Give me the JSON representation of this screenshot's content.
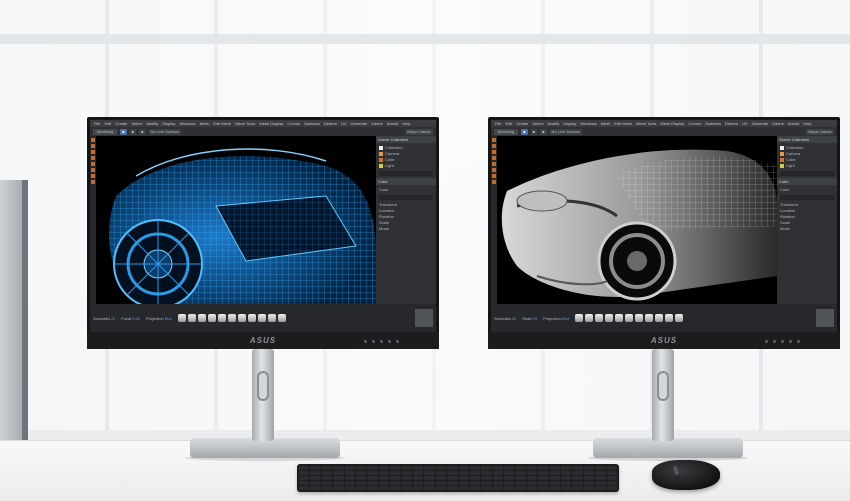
{
  "app": {
    "menu": [
      "File",
      "Edit",
      "Create",
      "Select",
      "Modify",
      "Display",
      "Windows",
      "Mesh",
      "Edit Mesh",
      "Mesh Tools",
      "Mesh Display",
      "Curves",
      "Surfaces",
      "Deform",
      "UV",
      "Generate",
      "Cache",
      "Arnold",
      "Help"
    ],
    "mode": "Modeling",
    "tool_chips": [
      "No Live Surface"
    ],
    "workspace": "Maya Classic"
  },
  "panel": {
    "outliner_title": "Scene Collection",
    "outliner_items": [
      {
        "label": "Collection",
        "color": "#f0f0f0"
      },
      {
        "label": "Camera",
        "color": "#e0a040"
      },
      {
        "label": "Cube",
        "color": "#e07030"
      },
      {
        "label": "Light",
        "color": "#d0d040"
      }
    ],
    "properties_title": "Cube",
    "section_color": "Color",
    "section_transform": "Transform",
    "fields": [
      "Location",
      "Rotation",
      "Scale",
      "Mode"
    ],
    "bottom_labels": [
      {
        "label": "Schmafia",
        "value": "20"
      },
      {
        "label": "Focal",
        "value": "0.62"
      },
      {
        "label": "Shaft",
        "value": "20"
      },
      {
        "label": "Projection",
        "value": "Blur"
      }
    ]
  },
  "screens": {
    "left": {
      "viewport_style": "blue-wireframe",
      "accent": "#2aa6ff"
    },
    "right": {
      "viewport_style": "white-wireframe",
      "accent": "#ffffff"
    }
  },
  "hardware": {
    "brand": "ASUS",
    "colors": {
      "bezel": "#141516",
      "stand": "#c9ccd0",
      "keyboard": "#1c1d1f"
    }
  }
}
